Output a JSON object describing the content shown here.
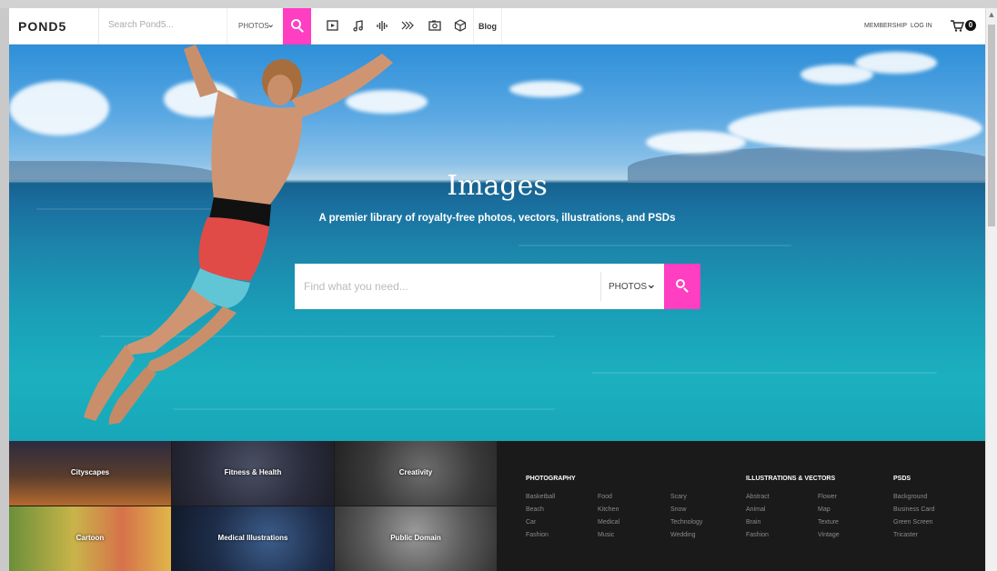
{
  "nav": {
    "logo": "POND5",
    "search_placeholder": "Search Pond5...",
    "search_type": "PHOTOS",
    "media_icons": [
      "video-icon",
      "music-icon",
      "sound-effects-icon",
      "after-effects-icon",
      "photo-icon",
      "3d-icon"
    ],
    "blog": "Blog",
    "membership": "MEMBERSHIP",
    "login": "LOG IN",
    "cart_count": "0"
  },
  "hero": {
    "title": "Images",
    "subtitle": "A premier library of royalty-free photos, vectors, illustrations, and PSDs",
    "search_placeholder": "Find what you need...",
    "search_type": "PHOTOS"
  },
  "tiles": [
    {
      "label": "Cityscapes"
    },
    {
      "label": "Fitness & Health"
    },
    {
      "label": "Creativity"
    },
    {
      "label": "Cartoon"
    },
    {
      "label": "Medical Illustrations"
    },
    {
      "label": "Public Domain"
    }
  ],
  "categories": {
    "photography": {
      "heading": "PHOTOGRAPHY",
      "col1": [
        "Basketball",
        "Beach",
        "Car",
        "Fashion"
      ],
      "col2": [
        "Food",
        "Kitchen",
        "Medical",
        "Music"
      ],
      "col3": [
        "Scary",
        "Snow",
        "Technology",
        "Wedding"
      ]
    },
    "illustrations": {
      "heading": "ILLUSTRATIONS & VECTORS",
      "col1": [
        "Abstract",
        "Animal",
        "Brain",
        "Fashion"
      ],
      "col2": [
        "Flower",
        "Map",
        "Texture",
        "Vintage"
      ]
    },
    "psds": {
      "heading": "PSDS",
      "col1": [
        "Background",
        "Business Card",
        "Green Screen",
        "Tricaster"
      ]
    }
  },
  "colors": {
    "accent": "#ff3ec2",
    "footer_bg": "#1a1a1a"
  }
}
